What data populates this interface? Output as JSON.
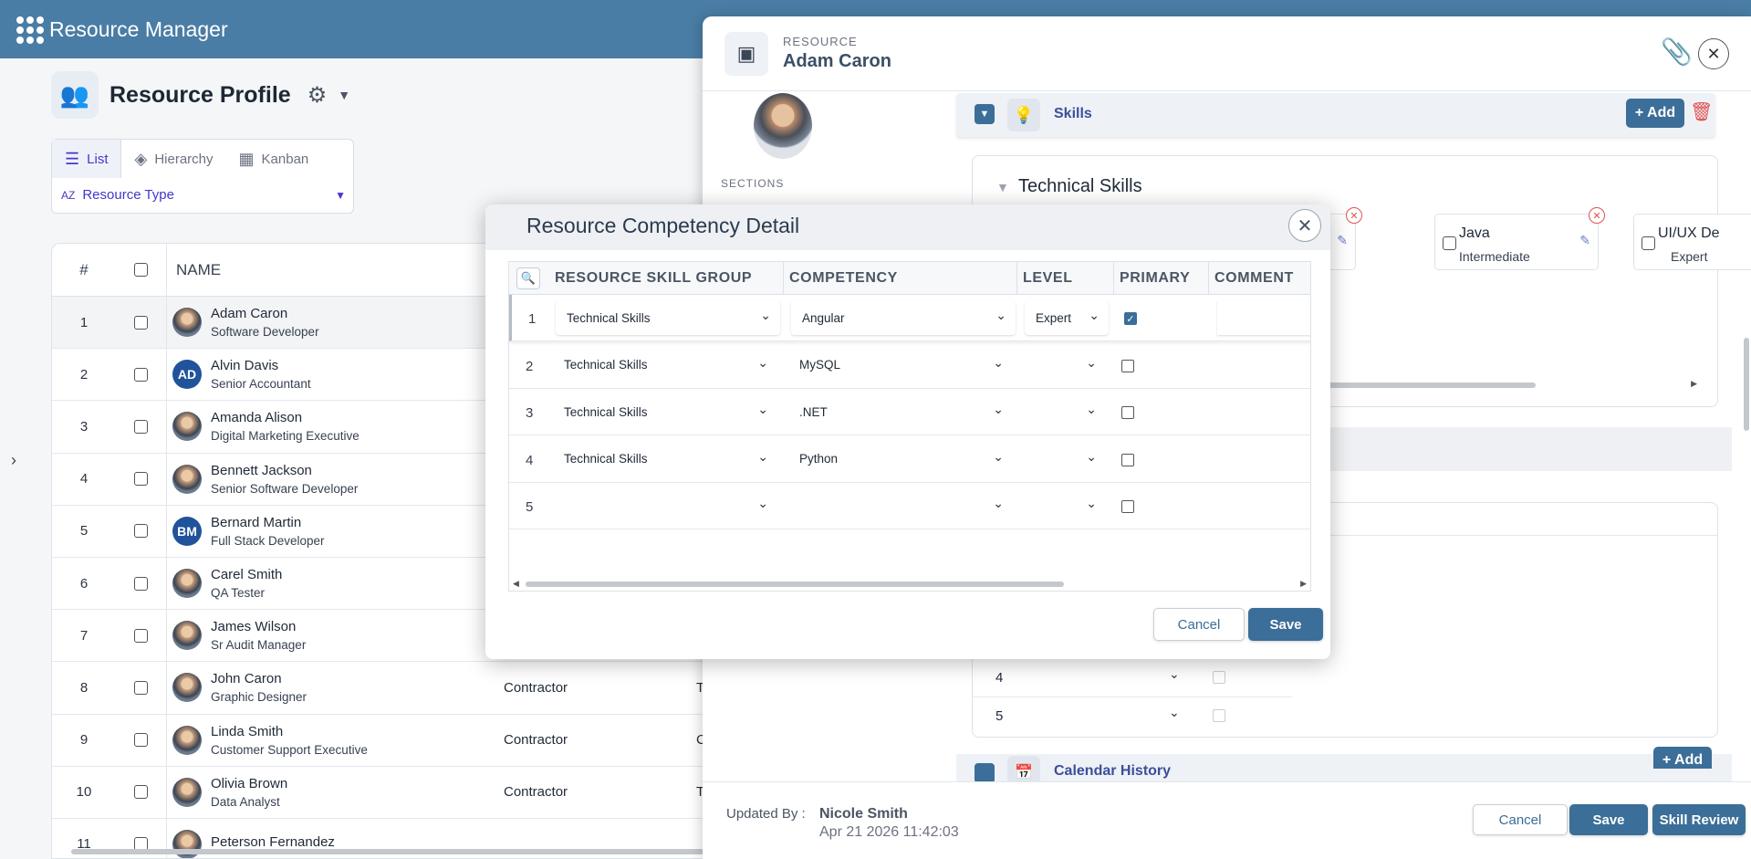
{
  "app": {
    "title": "Resource Manager"
  },
  "profile": {
    "title": "Resource Profile"
  },
  "views": {
    "list": "List",
    "hierarchy": "Hierarchy",
    "kanban": "Kanban",
    "group_by": "Resource Type"
  },
  "table": {
    "col_num": "#",
    "col_name": "NAME",
    "rows": [
      {
        "num": "1",
        "name": "Adam Caron",
        "role": "Software Developer",
        "type": "",
        "extra": ""
      },
      {
        "num": "2",
        "name": "Alvin Davis",
        "role": "Senior Accountant",
        "initials": "AD",
        "type": "",
        "extra": ""
      },
      {
        "num": "3",
        "name": "Amanda Alison",
        "role": "Digital Marketing Executive",
        "type": "",
        "extra": ""
      },
      {
        "num": "4",
        "name": "Bennett Jackson",
        "role": "Senior Software Developer",
        "type": "",
        "extra": ""
      },
      {
        "num": "5",
        "name": "Bernard Martin",
        "role": "Full Stack Developer",
        "initials": "BM",
        "type": "",
        "extra": ""
      },
      {
        "num": "6",
        "name": "Carel Smith",
        "role": "QA Tester",
        "type": "",
        "extra": ""
      },
      {
        "num": "7",
        "name": "James Wilson",
        "role": "Sr Audit Manager",
        "type": "",
        "extra": ""
      },
      {
        "num": "8",
        "name": "John Caron",
        "role": "Graphic Designer",
        "type": "Contractor",
        "extra": "T"
      },
      {
        "num": "9",
        "name": "Linda Smith",
        "role": "Customer Support Executive",
        "type": "Contractor",
        "extra": "C"
      },
      {
        "num": "10",
        "name": "Olivia Brown",
        "role": "Data Analyst",
        "type": "Contractor",
        "extra": "T"
      },
      {
        "num": "11",
        "name": "Peterson Fernandez",
        "role": "",
        "type": "",
        "extra": ""
      }
    ]
  },
  "panel": {
    "overline": "RESOURCE",
    "title": "Adam Caron",
    "sections_label": "SECTIONS",
    "skills_label": "Skills",
    "add_label": "+ Add",
    "technical_title": "Technical Skills",
    "skill_cards": [
      {
        "name": "Java",
        "level": "Intermediate"
      },
      {
        "name": "UI/UX De",
        "level": "Expert"
      }
    ],
    "lower_rows": [
      "4",
      "5"
    ],
    "calendar_label": "Calendar History",
    "updated_by_label": "Updated By",
    "updated_by_name": "Nicole Smith",
    "updated_at": "Apr 21 2026 11:42:03",
    "cancel_label": "Cancel",
    "save_label": "Save",
    "skill_review_label": "Skill Review"
  },
  "modal": {
    "title": "Resource Competency Detail",
    "headers": {
      "group": "RESOURCE SKILL GROUP",
      "competency": "COMPETENCY",
      "level": "LEVEL",
      "primary": "PRIMARY",
      "comment": "COMMENT"
    },
    "rows": [
      {
        "num": "1",
        "group": "Technical Skills",
        "competency": "Angular",
        "level": "Expert",
        "primary": true
      },
      {
        "num": "2",
        "group": "Technical Skills",
        "competency": "MySQL",
        "level": "",
        "primary": false
      },
      {
        "num": "3",
        "group": "Technical Skills",
        "competency": ".NET",
        "level": "",
        "primary": false
      },
      {
        "num": "4",
        "group": "Technical Skills",
        "competency": "Python",
        "level": "",
        "primary": false
      },
      {
        "num": "5",
        "group": "",
        "competency": "",
        "level": "",
        "primary": false
      }
    ],
    "cancel_label": "Cancel",
    "save_label": "Save"
  },
  "colors": {
    "header_bg": "#4a7da5",
    "primary": "#3b6e98",
    "accent_text": "#4438ca",
    "danger": "#e05252"
  }
}
